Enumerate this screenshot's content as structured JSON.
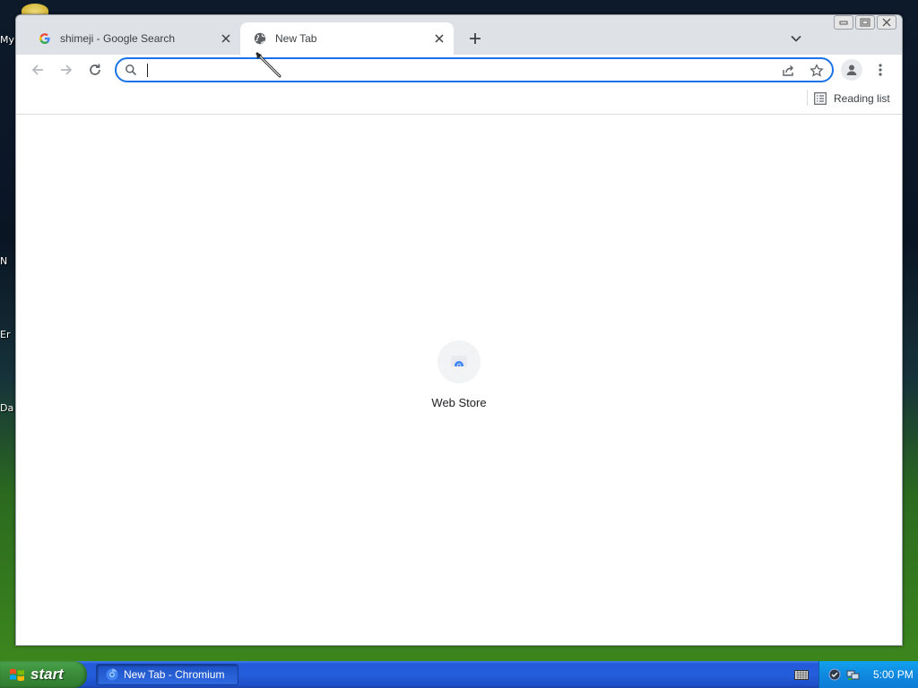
{
  "desktop": {
    "labels": [
      "My",
      "N",
      "Er",
      "Da"
    ]
  },
  "browser": {
    "tabs": [
      {
        "title": "shimeji - Google Search",
        "favicon": "google-g-icon",
        "active": false
      },
      {
        "title": "New Tab",
        "favicon": "globe-icon",
        "active": true
      }
    ],
    "omnibox": {
      "value": "",
      "placeholder": ""
    },
    "bookmarks_bar": {
      "reading_list_label": "Reading list"
    },
    "ntp": {
      "shortcuts": [
        {
          "label": "Web Store",
          "icon": "web-store-icon"
        }
      ]
    },
    "colors": {
      "accent": "#1a73e8",
      "tabstrip": "#dee1e6"
    }
  },
  "taskbar": {
    "start_label": "start",
    "tasks": [
      {
        "label": "New Tab - Chromium",
        "icon": "chromium-icon"
      }
    ],
    "clock": "5:00 PM"
  }
}
